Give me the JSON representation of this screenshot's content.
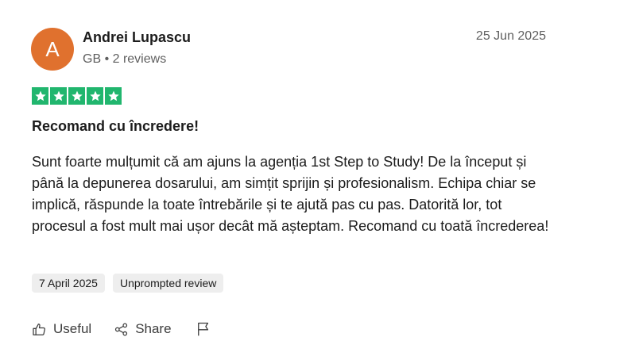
{
  "reviewer": {
    "initial": "A",
    "name": "Andrei Lupascu",
    "meta": "GB • 2 reviews",
    "avatar_color": "#e0712e"
  },
  "review": {
    "date": "25 Jun 2025",
    "rating": 5,
    "star_color": "#21b66e",
    "title": "Recomand cu încredere!",
    "body": "Sunt foarte mulțumit că am ajuns la agenția 1st Step to Study! De la început și până la depunerea dosarului, am simțit sprijin și profesionalism. Echipa chiar se implică, răspunde la toate întrebările și te ajută pas cu pas. Datorită lor, tot procesul a fost mult mai ușor decât mă așteptam. Recomand cu toată încrederea!",
    "experience_date": "7 April 2025",
    "tag": "Unprompted review"
  },
  "actions": {
    "useful_label": "Useful",
    "useful_icon": "thumbs-up-icon",
    "share_label": "Share",
    "share_icon": "share-icon",
    "report_icon": "flag-icon"
  }
}
